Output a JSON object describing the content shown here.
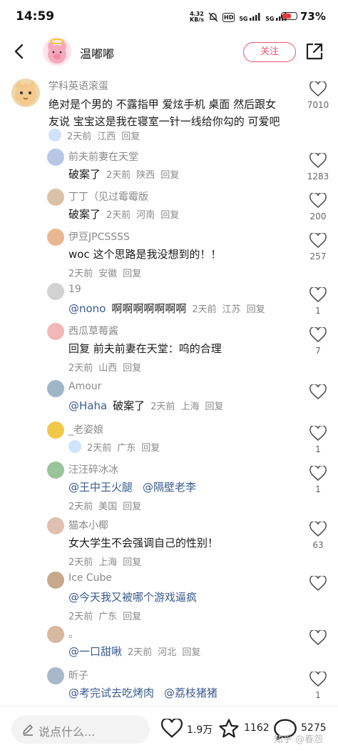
{
  "status_bar": {
    "time": "14:59",
    "speed_value": "4.32",
    "speed_unit": "KB/s",
    "hd": "HD",
    "sig1": "5G",
    "sig2": "5G",
    "battery": "73%",
    "battery_level": 0.73
  },
  "header": {
    "nickname": "温嘟嘟",
    "follow_label": "关注"
  },
  "top_comment": {
    "author": "学科英语滚蛋",
    "line1": "绝对是个男的  不露指甲  爱炫手机  桌面  然后跟女",
    "line2": "友说  宝宝这是我在寝室一针一线给你勾的  可爱吧",
    "time": "2天前",
    "location": "江西",
    "reply": "回复",
    "likes": "7010"
  },
  "replies": [
    {
      "author": "前夫前妻在天堂",
      "mention": "",
      "text": "破案了",
      "time": "2天前",
      "location": "陕西",
      "reply": "回复",
      "likes": "1283",
      "inline": true
    },
    {
      "author": "丁丁（见过霉霉版",
      "mention": "",
      "text": "破案了",
      "time": "2天前",
      "location": "河南",
      "reply": "回复",
      "likes": "200",
      "inline": true
    },
    {
      "author": "伊豆JPCSSSS",
      "mention": "",
      "text": "woc 这个思路是我没想到的！！",
      "time": "2天前",
      "location": "安徽",
      "reply": "回复",
      "likes": "257",
      "inline": false
    },
    {
      "author": "19",
      "mention": "@nono",
      "text": "啊啊啊啊啊啊啊",
      "time": "2天前",
      "location": "江苏",
      "reply": "回复",
      "likes": "1",
      "inline": true
    },
    {
      "author": "西瓜草莓酱",
      "mention": "",
      "text": "回复  前夫前妻在天堂：呜的合理",
      "time": "2天前",
      "location": "山西",
      "reply": "回复",
      "likes": "7",
      "inline": false
    },
    {
      "author": "Amour",
      "mention": "@Haha",
      "text": "破案了",
      "time": "2天前",
      "location": "上海",
      "reply": "回复",
      "likes": "",
      "inline": true
    },
    {
      "author": "_老姿娘",
      "mention": "",
      "text": "",
      "time": "2天前",
      "location": "广东",
      "reply": "回复",
      "likes": "1",
      "inline": false
    },
    {
      "author": "汪汪碎冰冰",
      "mention": "@王中王火腿",
      "mention2": "@隔壁老李",
      "text": "",
      "time": "2天前",
      "location": "美国",
      "reply": "回复",
      "likes": "1",
      "inline": false
    },
    {
      "author": "猫本小椰",
      "mention": "",
      "text": "女大学生不会强调自己的性别！",
      "time": "2天前",
      "location": "上海",
      "reply": "回复",
      "likes": "63",
      "inline": false
    },
    {
      "author": "Ice Cube",
      "mention": "@今天我又被哪个游戏逼疯",
      "text": "",
      "time": "2天前",
      "location": "广东",
      "reply": "回复",
      "likes": "",
      "inline": false
    },
    {
      "author": "。",
      "mention": "@一口甜啾",
      "text": "",
      "time": "2天前",
      "location": "河北",
      "reply": "回复",
      "likes": "",
      "inline": true
    },
    {
      "author": "昕子",
      "mention": "@考完试去吃烤肉",
      "mention2": "@荔枝猪猪",
      "text": "",
      "time": "",
      "location": "",
      "reply": "",
      "likes": "1",
      "inline": false
    }
  ],
  "bottom_bar": {
    "placeholder": "说点什么...",
    "likes": "1.9万",
    "favorites": "1162",
    "comments": "5275"
  },
  "watermark": "知乎 @春怨",
  "colors": {
    "accent": "#f25070",
    "mention": "#3a5b8f",
    "muted": "#8a8a8a"
  }
}
